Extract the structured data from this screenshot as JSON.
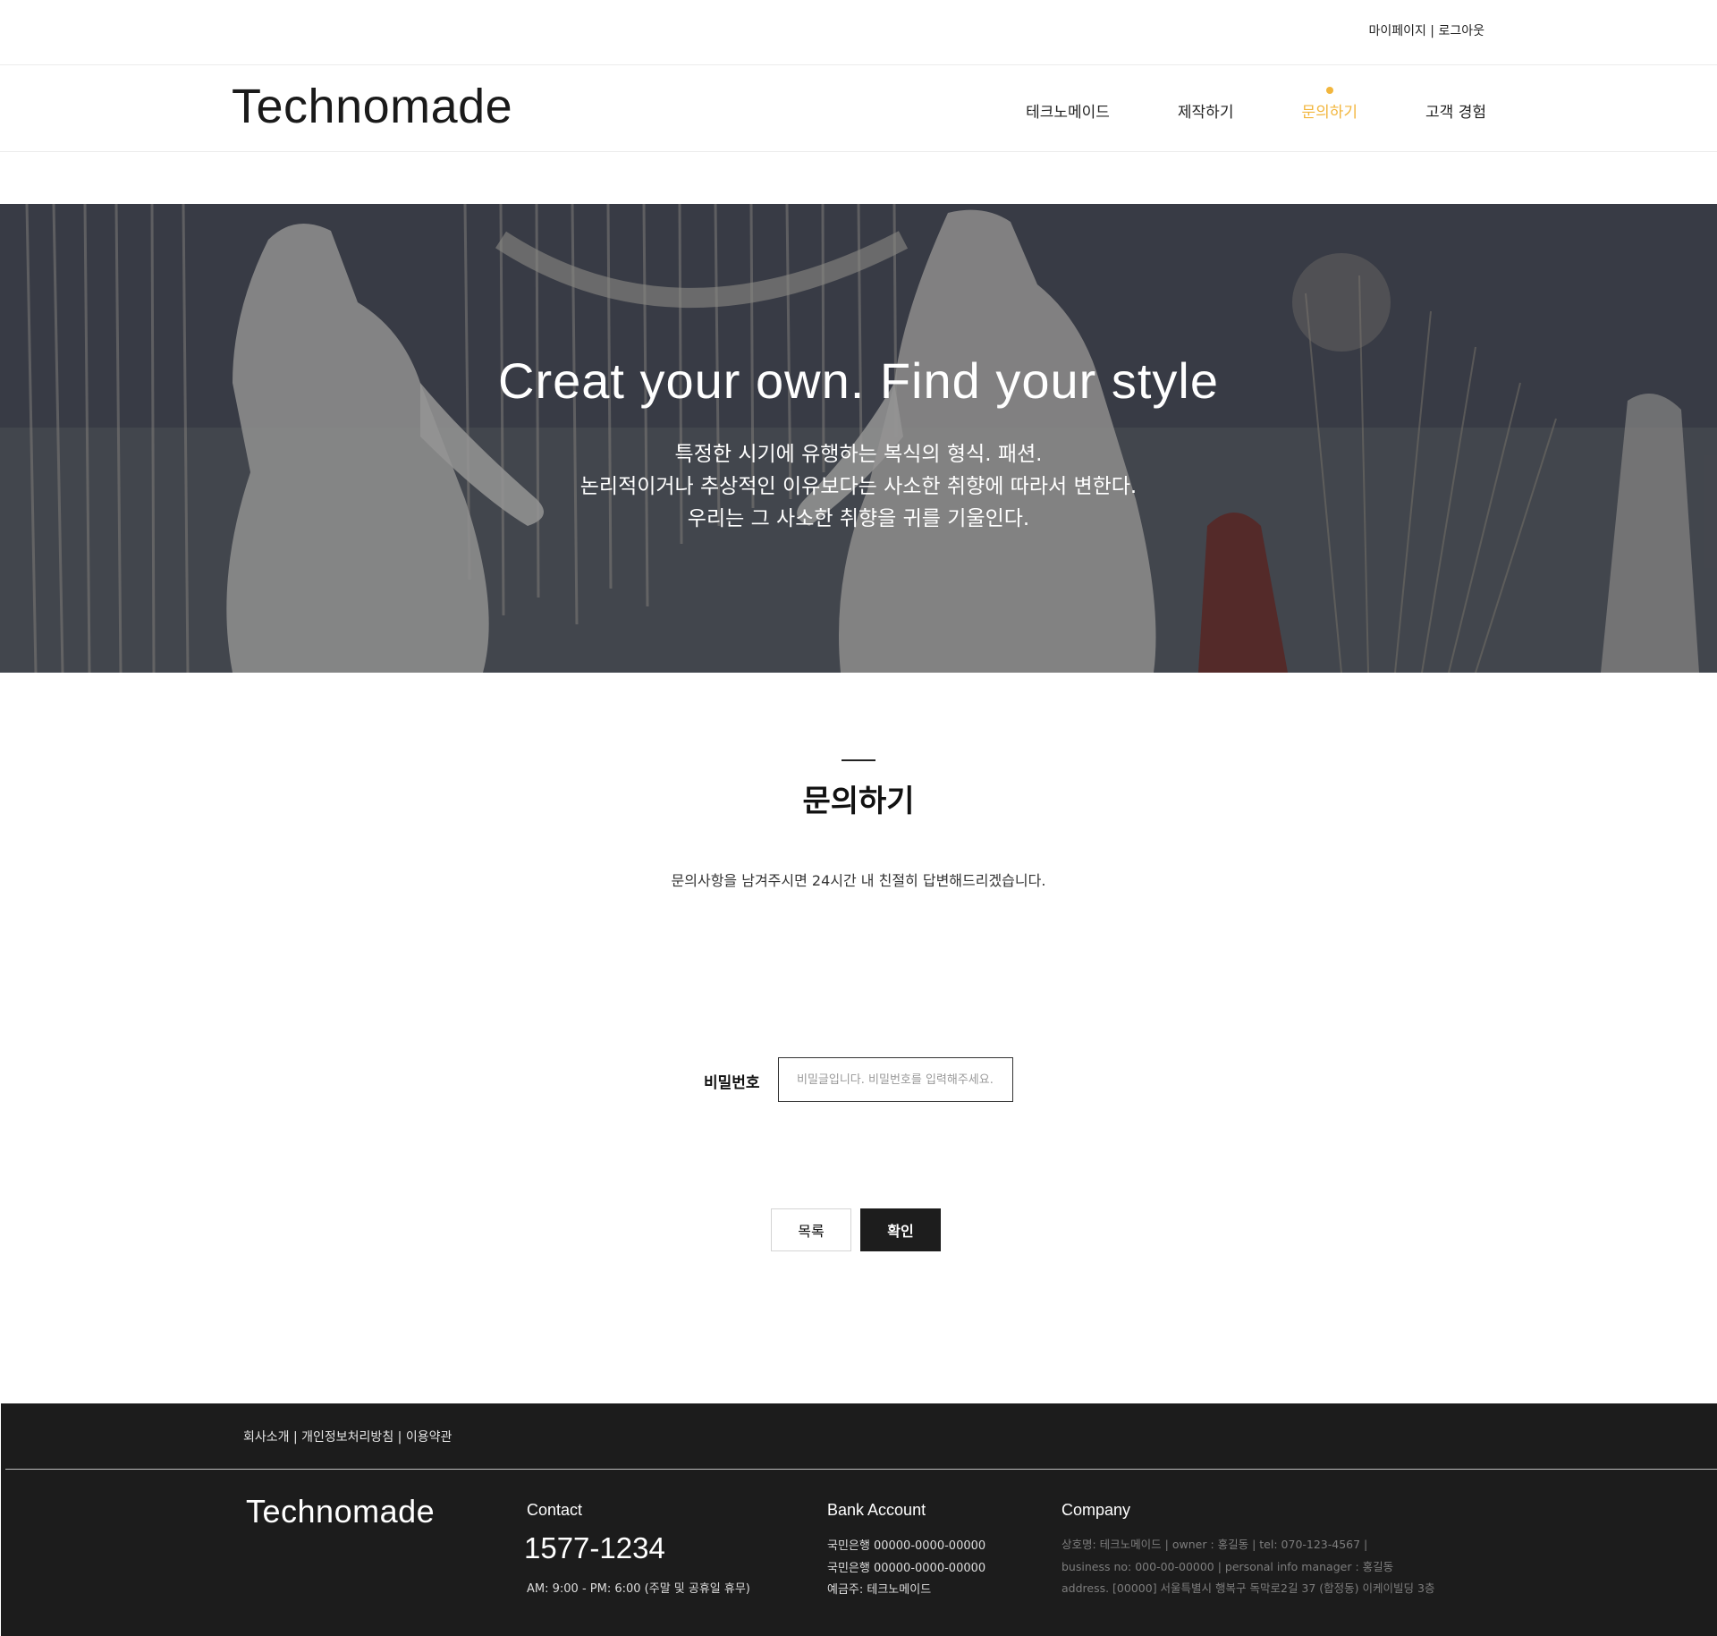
{
  "topbar": {
    "mypage": "마이페이지",
    "separator": " | ",
    "logout": "로그아웃"
  },
  "header": {
    "logo": "Technomade",
    "nav": [
      {
        "label": "테크노메이드",
        "active": false
      },
      {
        "label": "제작하기",
        "active": false
      },
      {
        "label": "문의하기",
        "active": true
      },
      {
        "label": "고객 경험",
        "active": false
      }
    ],
    "accent_color": "#f2b63d"
  },
  "hero": {
    "title": "Creat your own. Find your style",
    "lines": [
      "특정한 시기에 유행하는 복식의 형식. 패션.",
      "논리적이거나 추상적인 이유보다는 사소한 취향에 따라서 변한다.",
      "우리는 그 사소한 취향을 귀를 기울인다."
    ]
  },
  "content": {
    "title": "문의하기",
    "description": "문의사항을 남겨주시면 24시간 내 친절히 답변해드리겠습니다.",
    "password_label": "비밀번호",
    "password_placeholder": "비밀글입니다. 비밀번호를 입력해주세요.",
    "list_button": "목록",
    "confirm_button": "확인"
  },
  "footer": {
    "links": [
      "회사소개",
      "개인정보처리방침",
      "이용약관"
    ],
    "link_separator": " | ",
    "logo": "Technomade",
    "contact": {
      "title": "Contact",
      "phone": "1577-1234",
      "hours": "AM: 9:00 - PM: 6:00 (주말 및 공휴일 휴무)"
    },
    "bank": {
      "title": "Bank Account",
      "lines": [
        "국민은행 00000-0000-00000",
        "국민은행 00000-0000-00000",
        "예금주:    테크노메이드"
      ]
    },
    "company": {
      "title": "Company",
      "lines": [
        "상호명: 테크노메이드 |  owner : 홍길동 |  tel: 070-123-4567 |",
        "business no: 000-00-00000 | personal info manager : 홍길동",
        "address. [00000] 서울특별시 행복구 독막로2길 37 (합정동) 이케이빌딩 3층"
      ]
    }
  }
}
